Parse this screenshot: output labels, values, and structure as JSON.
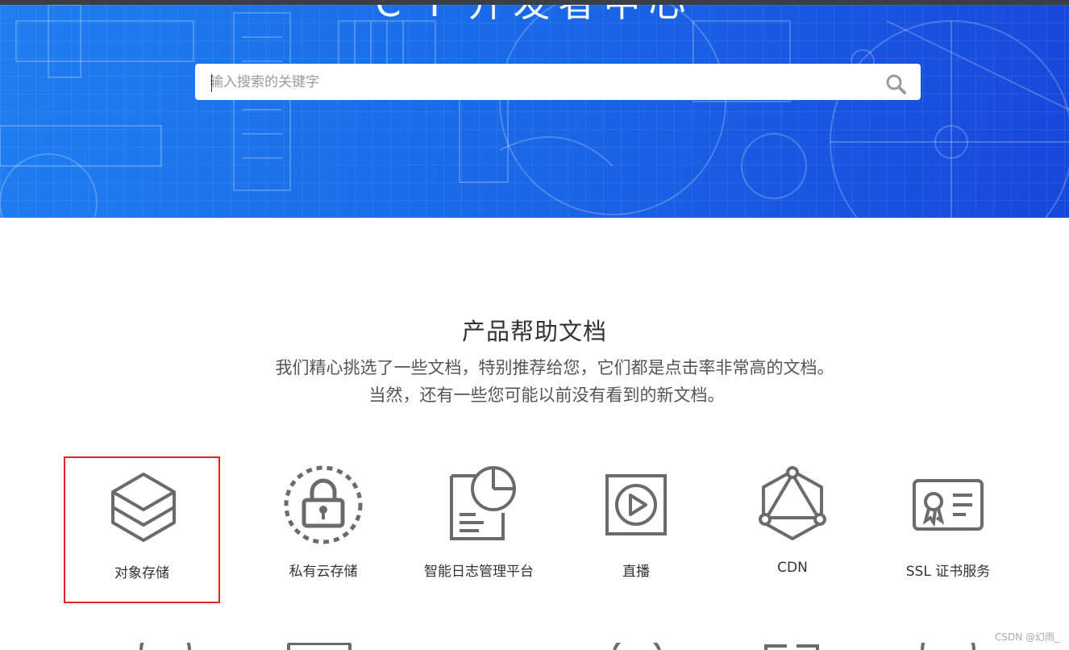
{
  "hero": {
    "title": "C I 开发者中心",
    "search": {
      "placeholder": "输入搜索的关键字"
    }
  },
  "section": {
    "title": "产品帮助文档",
    "desc_line1": "我们精心挑选了一些文档，特别推荐给您，它们都是点击率非常高的文档。",
    "desc_line2": "当然，还有一些您可能以前没有看到的新文档。"
  },
  "products": [
    {
      "label": "对象存储",
      "icon": "layers-cube-icon",
      "selected": true
    },
    {
      "label": "私有云存储",
      "icon": "padlock-icon"
    },
    {
      "label": "智能日志管理平台",
      "icon": "document-pie-chart-icon"
    },
    {
      "label": "直播",
      "icon": "play-icon"
    },
    {
      "label": "CDN",
      "icon": "network-triangle-icon"
    },
    {
      "label": "SSL 证书服务",
      "icon": "certificate-icon"
    }
  ],
  "watermark": "CSDN @幻雨_",
  "colors": {
    "hero_start": "#1f7ef0",
    "hero_end": "#1747db",
    "icon_gray": "#6b6b6b",
    "selection_red": "#e62222"
  }
}
